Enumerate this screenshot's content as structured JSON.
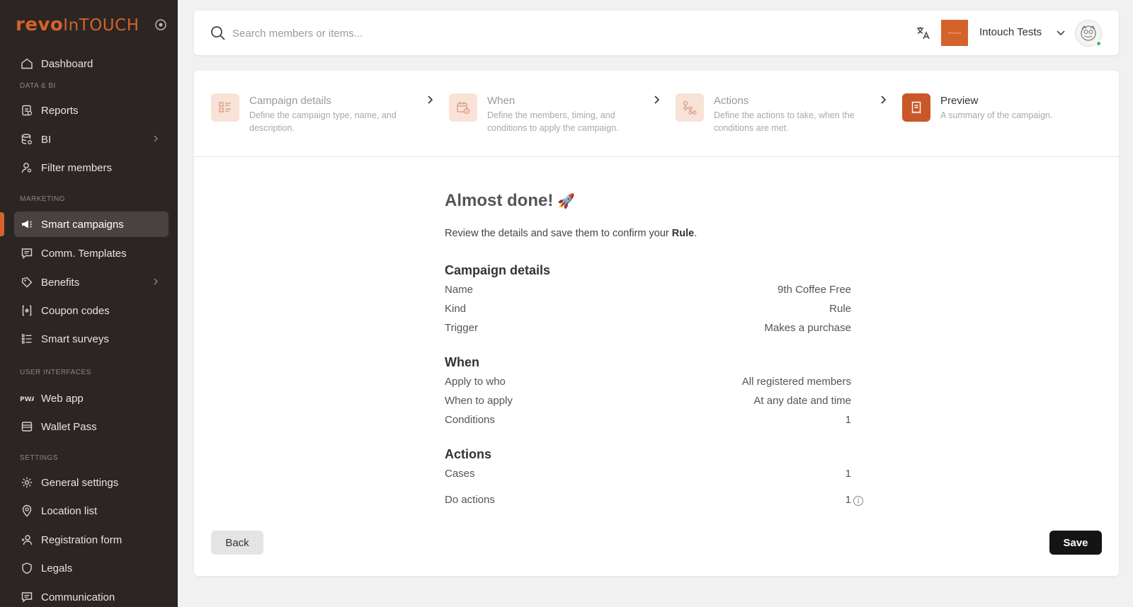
{
  "app": {
    "logo_part1": "revo",
    "logo_part2": "InTOUCH"
  },
  "sidebar": {
    "items": [
      {
        "label": "Dashboard"
      },
      {
        "label": "Reports"
      },
      {
        "label": "BI"
      },
      {
        "label": "Filter members"
      },
      {
        "label": "Smart campaigns"
      },
      {
        "label": "Comm. Templates"
      },
      {
        "label": "Benefits"
      },
      {
        "label": "Coupon codes"
      },
      {
        "label": "Smart surveys"
      },
      {
        "label": "Web app"
      },
      {
        "label": "Wallet Pass"
      },
      {
        "label": "General settings"
      },
      {
        "label": "Location list"
      },
      {
        "label": "Registration form"
      },
      {
        "label": "Legals"
      },
      {
        "label": "Communication"
      }
    ],
    "sections": {
      "data_bi": "DATA & BI",
      "marketing": "MARKETING",
      "user_interfaces": "USER INTERFACES",
      "settings": "SETTINGS"
    },
    "active_item": "Smart campaigns"
  },
  "header": {
    "search_placeholder": "Search members or items...",
    "org_name": "Intouch Tests",
    "org_logo_text": "INTOUCH"
  },
  "steps": [
    {
      "title": "Campaign details",
      "description": "Define the campaign type, name, and description."
    },
    {
      "title": "When",
      "description": "Define the members, timing, and conditions to apply the campaign."
    },
    {
      "title": "Actions",
      "description": "Define the actions to take, when the conditions are met."
    },
    {
      "title": "Preview",
      "description": "A summary of the campaign."
    }
  ],
  "current_step": "Preview",
  "summary": {
    "heading": "Almost done!",
    "heading_emoji": "🚀",
    "intro_prefix": "Review the details and save them to confirm your ",
    "intro_bold": "Rule",
    "intro_suffix": ".",
    "campaign_details": {
      "title": "Campaign details",
      "rows": [
        {
          "key": "Name",
          "value": "9th Coffee Free"
        },
        {
          "key": "Kind",
          "value": "Rule"
        },
        {
          "key": "Trigger",
          "value": "Makes a purchase"
        }
      ]
    },
    "when": {
      "title": "When",
      "rows": [
        {
          "key": "Apply to who",
          "value": "All registered members"
        },
        {
          "key": "When to apply",
          "value": "At any date and time"
        },
        {
          "key": "Conditions",
          "value": "1"
        }
      ]
    },
    "actions": {
      "title": "Actions",
      "rows": [
        {
          "key": "Cases",
          "value": "1"
        },
        {
          "key": "Do actions",
          "value": "1"
        }
      ]
    }
  },
  "buttons": {
    "back": "Back",
    "save": "Save"
  },
  "colors": {
    "brand": "#d4622b",
    "sidebar_bg": "#2b2624",
    "save_bg": "#141414"
  }
}
